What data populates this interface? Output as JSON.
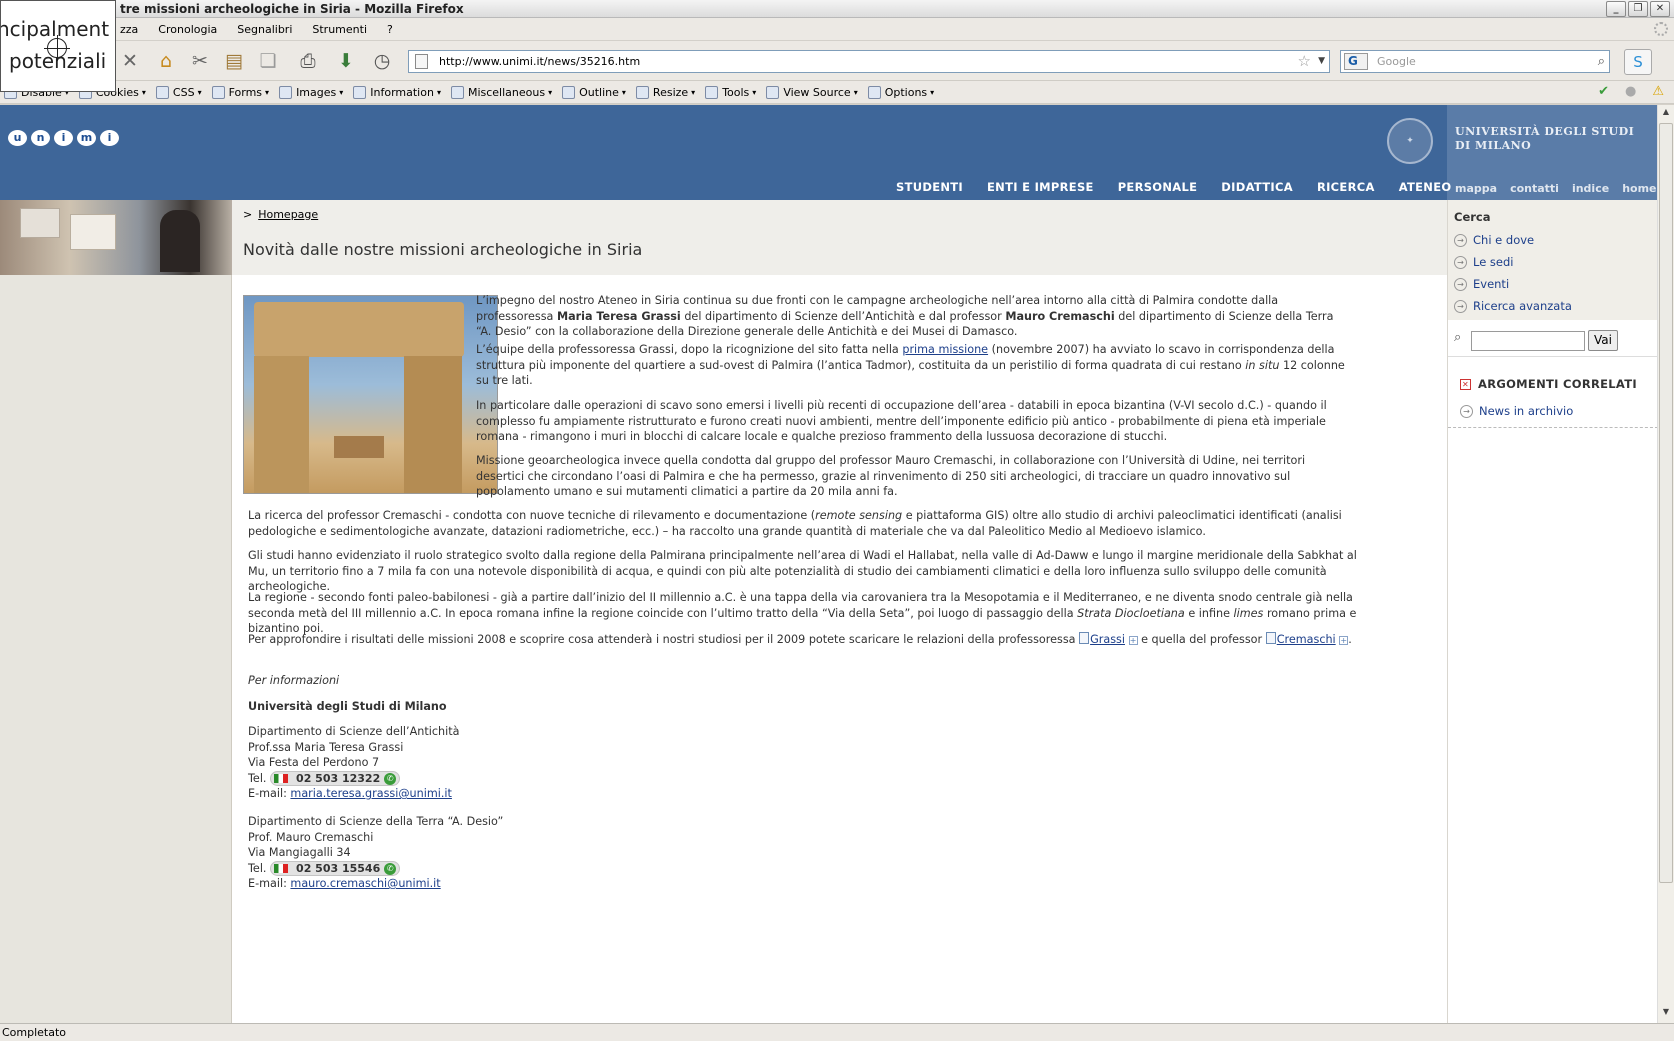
{
  "window": {
    "title": "tre missioni archeologiche in Siria - Mozilla Firefox"
  },
  "overlay": {
    "line1": "ncipalment",
    "line2": "potenziali"
  },
  "menu": [
    "zza",
    "Cronologia",
    "Segnalibri",
    "Strumenti",
    "?"
  ],
  "nav": {
    "url": "http://www.unimi.it/news/35216.htm",
    "search_placeholder": "Google"
  },
  "devbar": {
    "items": [
      "Disable",
      "Cookies",
      "CSS",
      "Forms",
      "Images",
      "Information",
      "Miscellaneous",
      "Outline",
      "Resize",
      "Tools",
      "View Source",
      "Options"
    ]
  },
  "status": "Completato",
  "header": {
    "logo": [
      "u",
      "n",
      "i",
      "m",
      "i"
    ],
    "uni_line1": "UNIVERSITÀ DEGLI STUDI",
    "uni_line2": "DI MILANO",
    "topnav": [
      "STUDENTI",
      "ENTI E IMPRESE",
      "PERSONALE",
      "DIDATTICA",
      "RICERCA",
      "ATENEO"
    ],
    "subnav": [
      "mappa",
      "contatti",
      "indice",
      "home"
    ]
  },
  "page": {
    "crumb": "Homepage",
    "title": "Novità dalle nostre missioni archeologiche in Siria",
    "p1a": "L’impegno del nostro Ateneo in Siria continua su due fronti con le campagne archeologiche nell’area intorno alla città di Palmira condotte dalla professoressa",
    "p1_name1": "Maria Teresa Grassi",
    "p1b": "del dipartimento di Scienze dell’Antichità e dal professor",
    "p1_name2": "Mauro Cremaschi",
    "p1c": "del dipartimento di Scienze della Terra “A. Desio” con la collaborazione della Direzione generale delle Antichità e dei Musei di Damasco.",
    "p2a": "L’équipe della professoressa Grassi, dopo la ricognizione del sito fatta nella",
    "p2_link": "prima missione",
    "p2b": "(novembre 2007) ha avviato lo scavo in corrispondenza della struttura più imponente del quartiere a sud-ovest di Palmira (l’antica Tadmor), costituita da un peristilio di forma quadrata di cui restano",
    "p2_it": "in situ",
    "p2c": "12 colonne su tre lati.",
    "p3": "In particolare dalle operazioni di scavo sono emersi i livelli più recenti di occupazione dell’area - databili in epoca bizantina (V-VI secolo d.C.) - quando il complesso fu ampiamente ristrutturato e furono creati nuovi ambienti, mentre dell’imponente edificio più antico - probabilmente di piena età imperiale romana - rimangono i muri in blocchi di calcare locale e qualche prezioso frammento della lussuosa decorazione di stucchi.",
    "p4": "Missione geoarcheologica invece quella condotta dal gruppo del professor Mauro Cremaschi, in collaborazione con l’Università di Udine, nei territori desertici che circondano l’oasi di Palmira e che ha permesso, grazie al rinvenimento di 250 siti archeologici, di tracciare un quadro innovativo sul popolamento umano e sui mutamenti climatici a partire da 20 mila anni fa.",
    "p5a": "La ricerca del professor Cremaschi - condotta con nuove tecniche di rilevamento e documentazione (",
    "p5_it": "remote sensing",
    "p5b": "e piattaforma GIS) oltre allo studio di archivi paleoclimatici identificati (analisi pedologiche e sedimentologiche avanzate, datazioni radiometriche, ecc.) – ha raccolto una grande quantità di materiale che va dal Paleolitico Medio al Medioevo islamico.",
    "p6": "Gli studi hanno evidenziato il ruolo strategico svolto dalla regione della Palmirana principalmente nell’area di Wadi el Hallabat, nella valle di Ad-Daww e lungo il margine meridionale della Sabkhat al Mu, un territorio fino a 7 mila fa con una notevole disponibilità di acqua, e quindi con più alte potenzialità di studio dei cambiamenti climatici e della loro influenza sullo sviluppo delle comunità archeologiche.",
    "p7a": "La regione - secondo fonti paleo-babilonesi - già a partire dall’inizio del II millennio a.C. è una tappa della via carovaniera tra la Mesopotamia e il Mediterraneo, e ne diventa snodo centrale già nella seconda metà del III millennio a.C. In epoca romana infine la regione coincide con l’ultimo tratto della “Via della Seta”, poi luogo di passaggio della",
    "p7_it1": "Strata Diocloetiana",
    "p7b": "e infine",
    "p7_it2": "limes",
    "p7c": "romano prima e bizantino poi.",
    "p8a": "Per approfondire i risultati delle missioni 2008 e scoprire cosa attenderà i nostri studiosi per il 2009 potete scaricare le relazioni della professoressa",
    "p8_link1": "Grassi",
    "p8b": "e quella del professor",
    "p8_link2": "Cremaschi",
    "p8c": ".",
    "info_title": "Per informazioni",
    "info_uni": "Università degli Studi di Milano",
    "c1_dept": "Dipartimento di Scienze dell’Antichità",
    "c1_name": "Prof.ssa Maria Teresa Grassi",
    "c1_addr": "Via Festa del Perdono 7",
    "c1_tel": "02 503 12322",
    "c1_email": "maria.teresa.grassi@unimi.it",
    "c2_dept": "Dipartimento di Scienze della Terra “A. Desio”",
    "c2_name": "Prof. Mauro Cremaschi",
    "c2_addr": "Via Mangiagalli 34",
    "c2_tel": "02 503 15546",
    "c2_email": "mauro.cremaschi@unimi.it",
    "tel_label": "Tel.",
    "email_label": "E-mail:"
  },
  "sidebar": {
    "cerca": "Cerca",
    "links": [
      "Chi e dove",
      "Le sedi",
      "Eventi",
      "Ricerca avanzata"
    ],
    "search_button": "Vai",
    "related_title": "ARGOMENTI CORRELATI",
    "related_link": "News in archivio"
  }
}
